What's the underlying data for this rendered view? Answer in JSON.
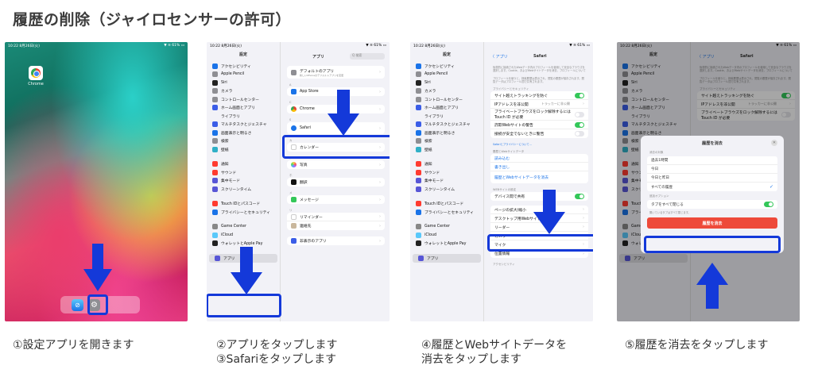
{
  "page": {
    "title": "履歴の削除（ジャイロセンサーの許可）"
  },
  "captions": {
    "step1": "①設定アプリを開きます",
    "step2a": "②アプリをタップします",
    "step2b": "③Safariをタップします",
    "step4a": "④履歴とWebサイトデータを",
    "step4b": "消去をタップします",
    "step5": "⑤履歴を消去をタップします"
  },
  "status": {
    "time": "10:22 8月26日(火)",
    "battery": "▼ ≋ 61% ▭"
  },
  "home": {
    "chrome_label": "Chrome",
    "dock_safari": "⊘",
    "dock_settings": "⚙"
  },
  "sidebar": {
    "title": "設定",
    "items": [
      {
        "label": "アクセシビリティ",
        "color": "#1a73e8"
      },
      {
        "label": "Apple Pencil",
        "color": "#8e8e93"
      },
      {
        "label": "Siri",
        "color": "#222222"
      },
      {
        "label": "カメラ",
        "color": "#8e8e93"
      },
      {
        "label": "コントロールセンター",
        "color": "#8e8e93"
      },
      {
        "label": "ホーム画面とアプリ",
        "color": "#3b5de7"
      },
      {
        "label": "ライブラリ",
        "color": ""
      },
      {
        "label": "マルチタスクとジェスチャ",
        "color": "#3b5de7"
      },
      {
        "label": "画面表示と明るさ",
        "color": "#1a73e8"
      },
      {
        "label": "検索",
        "color": "#8e8e93"
      },
      {
        "label": "壁紙",
        "color": "#30b0c7"
      }
    ],
    "items2": [
      {
        "label": "通知",
        "color": "#ff3b30"
      },
      {
        "label": "サウンド",
        "color": "#ff3b30"
      },
      {
        "label": "集中モード",
        "color": "#5856d6"
      },
      {
        "label": "スクリーンタイム",
        "color": "#5856d6"
      }
    ],
    "items3": [
      {
        "label": "Touch IDとパスコード",
        "color": "#ff3b30"
      },
      {
        "label": "プライバシーとセキュリティ",
        "color": "#1a73e8"
      }
    ],
    "items4": [
      {
        "label": "Game Center",
        "color": "#888888"
      },
      {
        "label": "iCloud",
        "color": "#5ac8fa"
      },
      {
        "label": "ウォレットとApple Pay",
        "color": "#222222"
      }
    ],
    "apps": {
      "label": "アプリ",
      "color": "#5856d6"
    }
  },
  "apps_screen": {
    "title": "アプリ",
    "search": "Q 検索",
    "default_apps": "デフォルトのアプリ",
    "default_sub": "新しいiPhoneのデフォルトアプリを変更",
    "letter_a": "A",
    "appstore": "App Store",
    "letter_c": "C",
    "chrome": "Chrome",
    "letter_s": "S",
    "safari": "Safari",
    "letter_k": "カ",
    "calendar": "カレンダー",
    "letter_sha": "シ",
    "photos": "写真",
    "letter_hon": "ホ",
    "translate": "翻訳",
    "letter_me": "メ",
    "messages": "メッセージ",
    "letter_ri": "リ",
    "reminders": "リマインダー",
    "contacts": "連絡先",
    "hidden": "非表示のアプリ"
  },
  "safari_screen": {
    "back": "〈 アプリ",
    "title": "Safari",
    "intro1": "仮想的に接続されたWebデータ内のプロフィールを使用して安全なブラウズを選択します。Cookie、およびWebサイトデータを消去、プロフィールについて",
    "intro2": "プロフィールを使うと、検索履歴は表示され、閲覧の履歴が保存されます。閲覧データはプロフィール間で共有されます。",
    "privacy_header": "プライバシーとセキュリティ",
    "cross_site": "サイト越えトラッキングを防ぐ",
    "hide_ip": "IPアドレスを非公開",
    "hide_ip_value": "トラッカーに非公開",
    "private_lock": "プライベートブラウズをロック解除するには Touch ID が必要",
    "fraud": "詐欺Webサイトの警告",
    "secure": "接続が安全でないときに警告",
    "about_link": "Safariとプライバシーについて…",
    "read_header": "履歴とWebサイトデータ",
    "reading_list": "読み込む",
    "import_link": "書き出し",
    "clear_history": "履歴とWebサイトデータを消去",
    "web_header": "WEBサイトの設定",
    "share_devices": "デバイス間で共有",
    "zoom": "ページの拡大/縮小",
    "desktop": "デスクトップ用Webサイトを表示",
    "reader": "リーダー",
    "camera": "カメラ",
    "mic": "マイク",
    "location": "位置情報",
    "access_header": "アクセシビリティ"
  },
  "modal": {
    "title": "履歴を消去",
    "close": "✕",
    "range_header": "消去の対象",
    "opt1": "過去1時間",
    "opt2": "今日",
    "opt3": "今日と昨日",
    "opt4": "すべての履歴",
    "check": "✓",
    "extra_header": "追加オプション",
    "close_tabs": "タブをすべて閉じる",
    "close_tabs_note": "開いているタブはすべて閉じます。",
    "clear_button": "履歴を消去"
  }
}
